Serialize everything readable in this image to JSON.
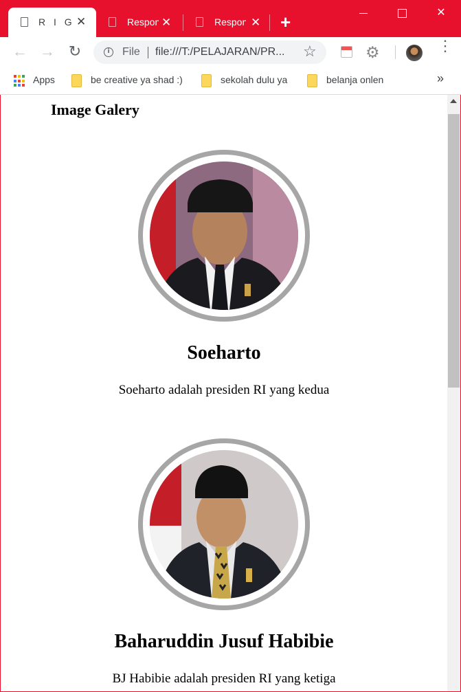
{
  "tabs": [
    {
      "title": "R I G",
      "active": true
    },
    {
      "title": "Respon",
      "active": false
    },
    {
      "title": "Respon",
      "active": false
    }
  ],
  "window_controls": {
    "minimize": "minimize",
    "maximize": "maximize",
    "close": "✕"
  },
  "toolbar": {
    "back": "←",
    "forward": "→",
    "reload": "↻",
    "scheme": "File",
    "url": "file:///T:/PELAJARAN/PR...",
    "star": "☆",
    "menu": "⋮"
  },
  "bookmarks": {
    "apps_label": "Apps",
    "items": [
      "be creative ya shad :)",
      "sekolah dulu ya",
      "belanja onlen"
    ],
    "more": "»"
  },
  "page": {
    "title": "Image Galery",
    "people": [
      {
        "name": "Soeharto",
        "description": "Soeharto adalah presiden RI yang kedua",
        "tie": "dark"
      },
      {
        "name": "Baharuddin Jusuf Habibie",
        "description": "BJ Habibie adalah presiden RI yang ketiga",
        "tie": "patterned"
      }
    ]
  },
  "colors": {
    "chrome_red": "#e8112d",
    "ring_gray": "#a6a6a6",
    "text": "#000000"
  }
}
